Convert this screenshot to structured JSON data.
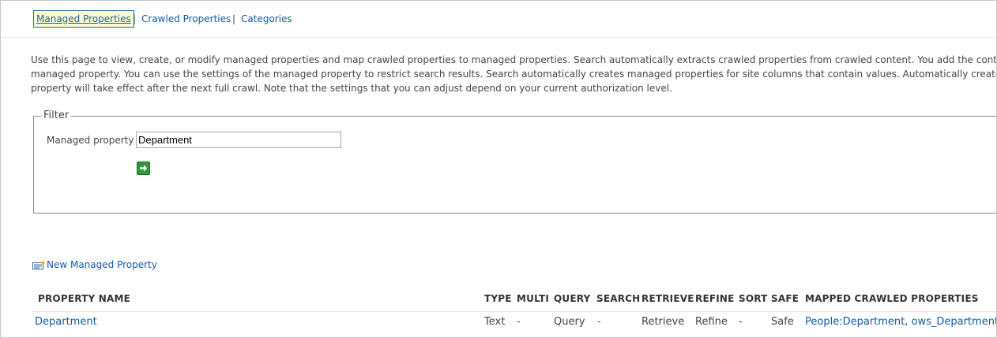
{
  "nav": {
    "tabs": [
      {
        "label": "Managed Properties",
        "active": true
      },
      {
        "label": "Crawled Properties",
        "active": false
      },
      {
        "label": "Categories",
        "active": false
      }
    ],
    "separator": "|"
  },
  "description": {
    "line1": "Use this page to view, create, or modify managed properties and map crawled properties to managed properties. Search automatically extracts crawled properties from crawled content. You add the content of a crawle",
    "line2": "managed property. You can use the settings of the managed property to restrict search results. Search automatically creates managed properties for site columns that contain values. Automatically created managed p",
    "line3": "property will take effect after the next full crawl. Note that the settings that you can adjust depend on your current authorization level."
  },
  "filter": {
    "legend": "Filter",
    "label": "Managed property",
    "value": "Department",
    "go_icon": "arrow-right-icon"
  },
  "new_property": {
    "label": "New Managed Property",
    "icon": "new-item-icon"
  },
  "table": {
    "headers": [
      "PROPERTY NAME",
      "TYPE",
      "MULTI",
      "QUERY",
      "SEARCH",
      "RETRIEVE",
      "REFINE",
      "SORT",
      "SAFE",
      "MAPPED CRAWLED PROPERTIES"
    ],
    "rows": [
      {
        "name": "Department",
        "type": "Text",
        "multi": "-",
        "query": "Query",
        "search": "-",
        "retrieve": "Retrieve",
        "refine": "Refine",
        "sort": "-",
        "safe": "Safe",
        "mapped": "People:Department, ows_Department"
      }
    ]
  },
  "colors": {
    "link": "#0f5ba7",
    "active_tab_bg": "#fbfbd3",
    "go_button": "#2e9a3a"
  }
}
